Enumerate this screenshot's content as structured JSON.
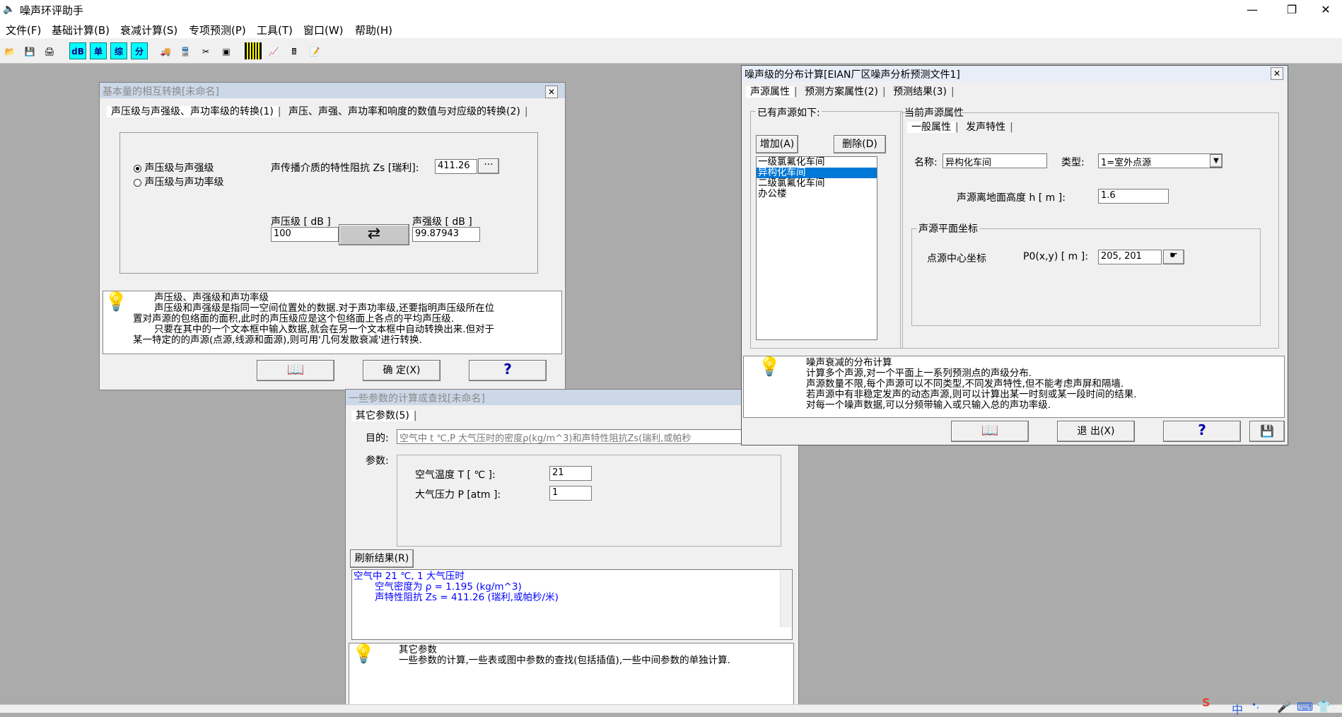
{
  "app": {
    "title": "噪声环评助手",
    "icon": "speaker-icon",
    "minimize": "—",
    "restore": "❐",
    "close": "✕"
  },
  "menu": [
    "文件(F)",
    "基础计算(B)",
    "衰减计算(S)",
    "专项预测(P)",
    "工具(T)",
    "窗口(W)",
    "帮助(H)"
  ],
  "toolbar": {
    "items": [
      "open-icon",
      "save-icon",
      "print-icon",
      "dB",
      "单",
      "综",
      "分",
      "truck-icon",
      "train-icon",
      "scissors-icon",
      "chart-icon",
      "grid-icon",
      "line-chart-icon",
      "calculator-icon",
      "notepad-icon"
    ],
    "labels": {
      "db": "dB",
      "dan": "单",
      "zong": "综",
      "fen": "分"
    }
  },
  "dialog1": {
    "title": "基本量的相互转换[未命名]",
    "tabs": [
      "声压级与声强级、声功率级的转换(1)",
      "声压、声强、声功率和响度的数值与对应级的转换(2)"
    ],
    "radio1": "声压级与声强级",
    "radio2": "声压级与声功率级",
    "impedance_label": "声传播介质的特性阻抗 Zs [瑞利]:",
    "impedance_value": "411.26",
    "browse": "···",
    "spl_label": "声压级 [ dB ]",
    "spl_value": "100",
    "sil_label": "声强级 [ dB ]",
    "sil_value": "99.87943",
    "hint": [
      "声压级、声强级和声功率级",
      "声压级和声强级是指同一空间位置处的数据.对于声功率级,还要指明声压级所在位",
      "置对声源的包络面的面积,此时的声压级应是这个包络面上各点的平均声压级.",
      "只要在其中的一个文本框中输入数据,就会在另一个文本框中自动转换出来.但对于",
      "某一特定的的声源(点源,线源和面源),则可用'几何发散衰减'进行转换."
    ],
    "ok": "确 定(X)",
    "help": "?"
  },
  "dialog2": {
    "title": "一些参数的计算或查找[未命名]",
    "tab": "其它参数(5)",
    "purpose_label": "目的:",
    "purpose_value": "空气中 t ℃,P 大气压时的密度ρ(kg/m^3)和声特性阻抗Zs(瑞利,或帕秒",
    "params_label": "参数:",
    "temp_label": "空气温度 T [ ℃ ]:",
    "temp_value": "21",
    "pressure_label": "大气压力 P [atm ]:",
    "pressure_value": "1",
    "refresh": "刷新结果(R)",
    "result": [
      "空气中 21 ℃, 1 大气压时",
      "空气密度为 ρ = 1.195 (kg/m^3)",
      "声特性阻抗 Zs = 411.26 (瑞利,或帕秒/米)"
    ],
    "hint": [
      "其它参数",
      "一些参数的计算,一些表或图中参数的查找(包括插值),一些中间参数的单独计算."
    ]
  },
  "dialog3": {
    "title": "噪声级的分布计算[EIAN厂区噪声分析预测文件1]",
    "tabs": [
      "声源属性",
      "预测方案属性(2)",
      "预测结果(3)"
    ],
    "sources_group": "已有声源如下:",
    "add": "增加(A)",
    "delete": "删除(D)",
    "sources": [
      "一级氯氟化车间",
      "异构化车间",
      "二级氯氟化车间",
      "办公楼"
    ],
    "selected_index": 1,
    "current_group": "当前声源属性",
    "subtabs": [
      "一般属性",
      "发声特性"
    ],
    "name_label": "名称:",
    "name_value": "异构化车间",
    "type_label": "类型:",
    "type_value": "1=室外点源",
    "height_label": "声源离地面高度   h [ m ]:",
    "height_value": "1.6",
    "coord_group": "声源平面坐标",
    "coord_label": "点源中心坐标",
    "coord_unit": "P0(x,y) [ m ]:",
    "coord_value": "205, 201",
    "hint": [
      "噪声衰减的分布计算",
      "计算多个声源,对一个平面上一系列预测点的声级分布.",
      "声源数量不限,每个声源可以不同类型,不同发声特性,但不能考虑声屏和隔墙.",
      "若声源中有非稳定发声的动态声源,则可以计算出某一时刻或某一段时间的结果.",
      "对每一个噪声数据,可以分频带输入或只输入总的声功率级."
    ],
    "exit": "退 出(X)",
    "help": "?"
  },
  "tray": {
    "ime": "中",
    "icons": [
      "punct-icon",
      "mic-icon",
      "keyboard-icon",
      "shirt-icon"
    ]
  }
}
